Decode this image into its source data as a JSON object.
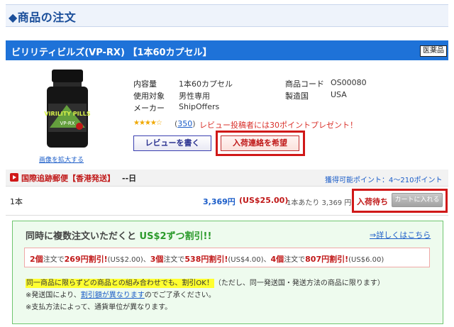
{
  "section": {
    "title": "◆商品の注文"
  },
  "product": {
    "title": "ビリリティビルズ(VP-RX) 【1本60カプセル】",
    "badge": "医薬品",
    "image_label": "VIRILITY PILLS VP-RX",
    "image_label_line1": "VIRILITY PILLS",
    "image_label_line2": "VP-RX",
    "enlarge_link": "画像を拡大する",
    "specs": {
      "content_label": "内容量",
      "content_value": "1本60カプセル",
      "target_label": "使用対象",
      "target_value": "男性専用",
      "maker_label": "メーカー",
      "maker_value": "ShipOffers",
      "code_label": "商品コード",
      "code_value": "OS00080",
      "country_label": "製造国",
      "country_value": "USA"
    },
    "rating_stars": "★★★★☆",
    "review_count_prefix": "(",
    "review_count": "350",
    "review_count_suffix": ")",
    "review_promo": "レビュー投稿者には30ポイントプレゼント！",
    "review_button": "レビューを書く",
    "restock_button": "入荷連絡を希望"
  },
  "shipping": {
    "method": "国際追跡郵便【香港発送】",
    "days": "--日",
    "points": "獲得可能ポイント：4～210ポイント"
  },
  "price_row": {
    "qty": "1本",
    "price_jpy": "3,369円",
    "price_usd": "(US$25.00)",
    "unit_price": "1本あたり 3,369 円",
    "status": "入荷待ち",
    "cart_button": "カートに入れる"
  },
  "discount": {
    "title_prefix": "同時に複数注文いただくと",
    "title_highlight": "US$2ずつ割引!!",
    "details_link": "⇒詳しくはこちら",
    "tiers": [
      {
        "qty": "2個",
        "mid": "注文で",
        "amount": "269円割引!",
        "usd": "(US$2.00)、"
      },
      {
        "qty": "3個",
        "mid": "注文で",
        "amount": "538円割引!",
        "usd": "(US$4.00)、"
      },
      {
        "qty": "4個",
        "mid": "注文で",
        "amount": "807円割引!",
        "usd": "(US$6.00)"
      }
    ],
    "note_highlight": "同一商品に限らずどの商品との組み合わせでも、割引OK！",
    "note_rest": "（ただし、同一発送国・発送方法の商品に限ります）",
    "note2_prefix": "※発送国により、",
    "note2_link": "割引額が異なります",
    "note2_suffix": "のでご了承ください。",
    "note3": "※支払方法によって、通貨単位が異なります。"
  },
  "colors": {
    "title_bar": "#1e72d8",
    "accent_red": "#d01818",
    "link_blue": "#1a5cc8",
    "discount_green": "#2a9a2a"
  }
}
